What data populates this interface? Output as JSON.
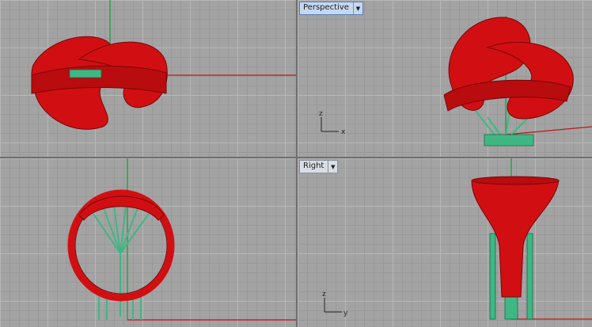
{
  "viewports": {
    "top_right": {
      "label": "Perspective",
      "active": true
    },
    "bottom_right": {
      "label": "Right",
      "active": false
    }
  },
  "axes": {
    "perspective": {
      "h": "x",
      "v": "z"
    },
    "right": {
      "h": "y",
      "v": "z"
    }
  },
  "icons": {
    "viewport_menu": "chevron-down-icon"
  },
  "colors": {
    "model_red": "#d10f12",
    "support_green": "#3fb783",
    "axis_red": "#c21616",
    "axis_green": "#0fa03a",
    "grid_bg": "#a3a3a3"
  }
}
